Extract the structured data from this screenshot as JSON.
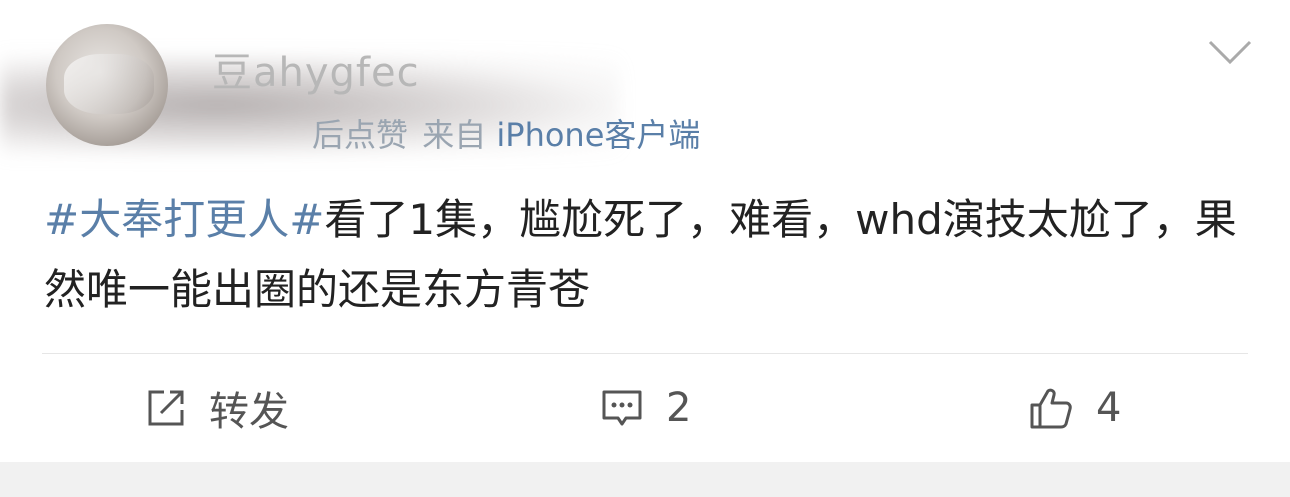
{
  "user": {
    "name": "豆ahygfec",
    "post_time": "后点赞",
    "source_prefix": "来自",
    "source_link": "iPhone客户端"
  },
  "post": {
    "hashtag": "#大奉打更人#",
    "text": "看了1集，尴尬死了，难看，whd演技太尬了，果然唯一能出圈的还是东方青苍"
  },
  "actions": {
    "forward_label": "转发",
    "comment_count": "2",
    "like_count": "4"
  },
  "colors": {
    "link": "#5a7fa8",
    "text": "#222222",
    "muted": "#9aa5b1",
    "action": "#555555",
    "bottom_band": "#f1f1f1"
  },
  "icons": {
    "menu": "chevron-down-icon",
    "forward": "share-icon",
    "comment": "comment-icon",
    "like": "thumbs-up-icon"
  }
}
